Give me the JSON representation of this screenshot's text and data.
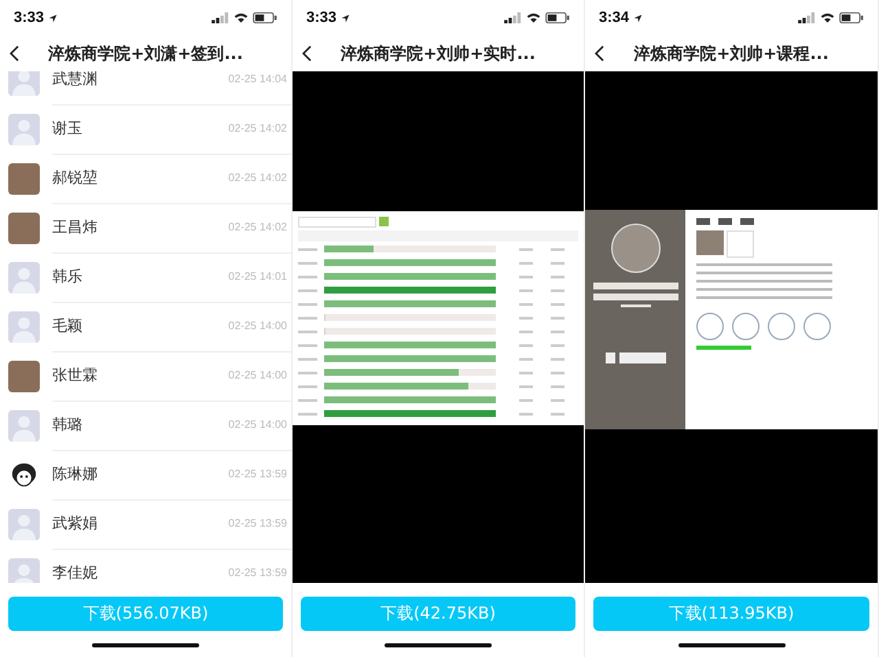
{
  "panels": [
    {
      "kind": "list",
      "time": "3:33",
      "title": "淬炼商学院+刘潇+签到...",
      "download": "下载(556.07KB)",
      "rows": [
        {
          "name": "武慧渊",
          "time": "02-25 14:04",
          "kind": "default"
        },
        {
          "name": "谢玉",
          "time": "02-25 14:02",
          "kind": "default"
        },
        {
          "name": "郝锐堃",
          "time": "02-25 14:02",
          "kind": "photo"
        },
        {
          "name": "王昌炜",
          "time": "02-25 14:02",
          "kind": "photo"
        },
        {
          "name": "韩乐",
          "time": "02-25 14:01",
          "kind": "default"
        },
        {
          "name": "毛颖",
          "time": "02-25 14:00",
          "kind": "default"
        },
        {
          "name": "张世霖",
          "time": "02-25 14:00",
          "kind": "photo"
        },
        {
          "name": "韩璐",
          "time": "02-25 14:00",
          "kind": "default"
        },
        {
          "name": "陈琳娜",
          "time": "02-25 13:59",
          "kind": "cartoon"
        },
        {
          "name": "武紫娟",
          "time": "02-25 13:59",
          "kind": "default"
        },
        {
          "name": "李佳妮",
          "time": "02-25 13:59",
          "kind": "default"
        }
      ]
    },
    {
      "kind": "bars",
      "time": "3:33",
      "title": "淬炼商学院+刘帅+实时...",
      "download": "下载(42.75KB)",
      "bars": [
        {
          "level": 0.29,
          "color": "#7cbd7c"
        },
        {
          "level": 1,
          "color": "#7cbd7c"
        },
        {
          "level": 1,
          "color": "#7cbd7c"
        },
        {
          "level": 1,
          "color": "#2f9e3f"
        },
        {
          "level": 1,
          "color": "#7cbd7c"
        },
        {
          "level": 0
        },
        {
          "level": 0
        },
        {
          "level": 1,
          "color": "#7cbd7c"
        },
        {
          "level": 1,
          "color": "#7cbd7c"
        },
        {
          "level": 0.78,
          "color": "#7cbd7c"
        },
        {
          "level": 0.84,
          "color": "#7cbd7c"
        },
        {
          "level": 1,
          "color": "#7cbd7c"
        },
        {
          "level": 1,
          "color": "#2f9e3f"
        }
      ]
    },
    {
      "kind": "group",
      "time": "3:34",
      "title": "淬炼商学院+刘帅+课程...",
      "download": "下载(113.95KB)"
    }
  ]
}
